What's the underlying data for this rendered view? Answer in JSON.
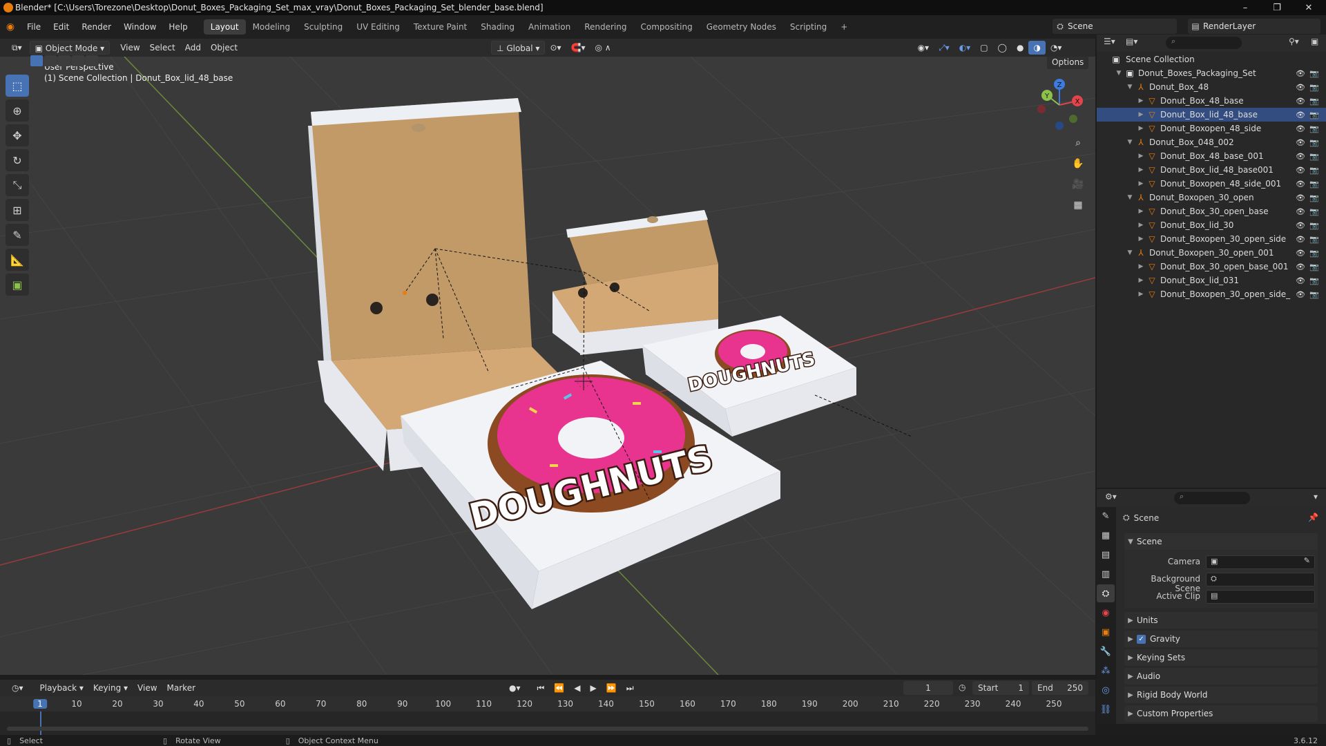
{
  "window": {
    "title": "Blender* [C:\\Users\\Torezone\\Desktop\\Donut_Boxes_Packaging_Set_max_vray\\Donut_Boxes_Packaging_Set_blender_base.blend]",
    "minimize": "–",
    "maximize": "❐",
    "close": "✕"
  },
  "menu": [
    "File",
    "Edit",
    "Render",
    "Window",
    "Help"
  ],
  "workspaces": [
    "Layout",
    "Modeling",
    "Sculpting",
    "UV Editing",
    "Texture Paint",
    "Shading",
    "Animation",
    "Rendering",
    "Compositing",
    "Geometry Nodes",
    "Scripting"
  ],
  "workspace_add": "+",
  "scene_selector": "Scene",
  "renderlayer_selector": "RenderLayer",
  "viewport_header": {
    "mode": "Object Mode",
    "menus": [
      "View",
      "Select",
      "Add",
      "Object"
    ],
    "transform": "Global",
    "options": "Options"
  },
  "viewport": {
    "perspective": "User Perspective",
    "context": "(1) Scene Collection | Donut_Box_lid_48_base",
    "gizmo_axes": [
      "X",
      "Y",
      "Z"
    ],
    "box_label_large": "DOUGHNUTS",
    "box_label_small": "DOUGHNUTS"
  },
  "tools": [
    "select-box",
    "cursor",
    "move",
    "rotate",
    "scale",
    "transform",
    "annotate",
    "measure",
    "add-cube"
  ],
  "outliner": {
    "root": "Scene Collection",
    "items": [
      {
        "label": "Donut_Boxes_Packaging_Set",
        "level": 1,
        "kind": "collection"
      },
      {
        "label": "Donut_Box_48",
        "level": 2,
        "kind": "empty"
      },
      {
        "label": "Donut_Box_48_base",
        "level": 3,
        "kind": "mesh"
      },
      {
        "label": "Donut_Box_lid_48_base",
        "level": 3,
        "kind": "mesh",
        "selected": true
      },
      {
        "label": "Donut_Boxopen_48_side",
        "level": 3,
        "kind": "mesh"
      },
      {
        "label": "Donut_Box_048_002",
        "level": 2,
        "kind": "empty"
      },
      {
        "label": "Donut_Box_48_base_001",
        "level": 3,
        "kind": "mesh"
      },
      {
        "label": "Donut_Box_lid_48_base001",
        "level": 3,
        "kind": "mesh"
      },
      {
        "label": "Donut_Boxopen_48_side_001",
        "level": 3,
        "kind": "mesh"
      },
      {
        "label": "Donut_Boxopen_30_open",
        "level": 2,
        "kind": "empty"
      },
      {
        "label": "Donut_Box_30_open_base",
        "level": 3,
        "kind": "mesh"
      },
      {
        "label": "Donut_Box_lid_30",
        "level": 3,
        "kind": "mesh"
      },
      {
        "label": "Donut_Boxopen_30_open_side",
        "level": 3,
        "kind": "mesh"
      },
      {
        "label": "Donut_Boxopen_30_open_001",
        "level": 2,
        "kind": "empty"
      },
      {
        "label": "Donut_Box_30_open_base_001",
        "level": 3,
        "kind": "mesh"
      },
      {
        "label": "Donut_Box_lid_031",
        "level": 3,
        "kind": "mesh"
      },
      {
        "label": "Donut_Boxopen_30_open_side_",
        "level": 3,
        "kind": "mesh"
      }
    ]
  },
  "properties": {
    "title": "Scene",
    "panel": "Scene",
    "fields": [
      {
        "label": "Camera",
        "value": ""
      },
      {
        "label": "Background Scene",
        "value": ""
      },
      {
        "label": "Active Clip",
        "value": ""
      }
    ],
    "sections": [
      "Units",
      "Gravity",
      "Keying Sets",
      "Audio",
      "Rigid Body World",
      "Custom Properties"
    ],
    "gravity_checked": true
  },
  "timeline": {
    "menus": [
      "Playback",
      "Keying",
      "View",
      "Marker"
    ],
    "current_frame": "1",
    "start_label": "Start",
    "start": "1",
    "end_label": "End",
    "end": "250",
    "ticks": [
      "1",
      "10",
      "20",
      "30",
      "40",
      "50",
      "60",
      "70",
      "80",
      "90",
      "100",
      "110",
      "120",
      "130",
      "140",
      "150",
      "160",
      "170",
      "180",
      "190",
      "200",
      "210",
      "220",
      "230",
      "240",
      "250"
    ]
  },
  "statusbar": {
    "select": "Select",
    "rotate": "Rotate View",
    "context": "Object Context Menu",
    "version": "3.6.12"
  },
  "colors": {
    "accent": "#4772b3",
    "x_axis": "#e2444c",
    "y_axis": "#8cc14a",
    "z_axis": "#3d7be0",
    "donut_pink": "#e8338f",
    "donut_brown": "#8b4a22",
    "cardboard": "#c29a67"
  }
}
